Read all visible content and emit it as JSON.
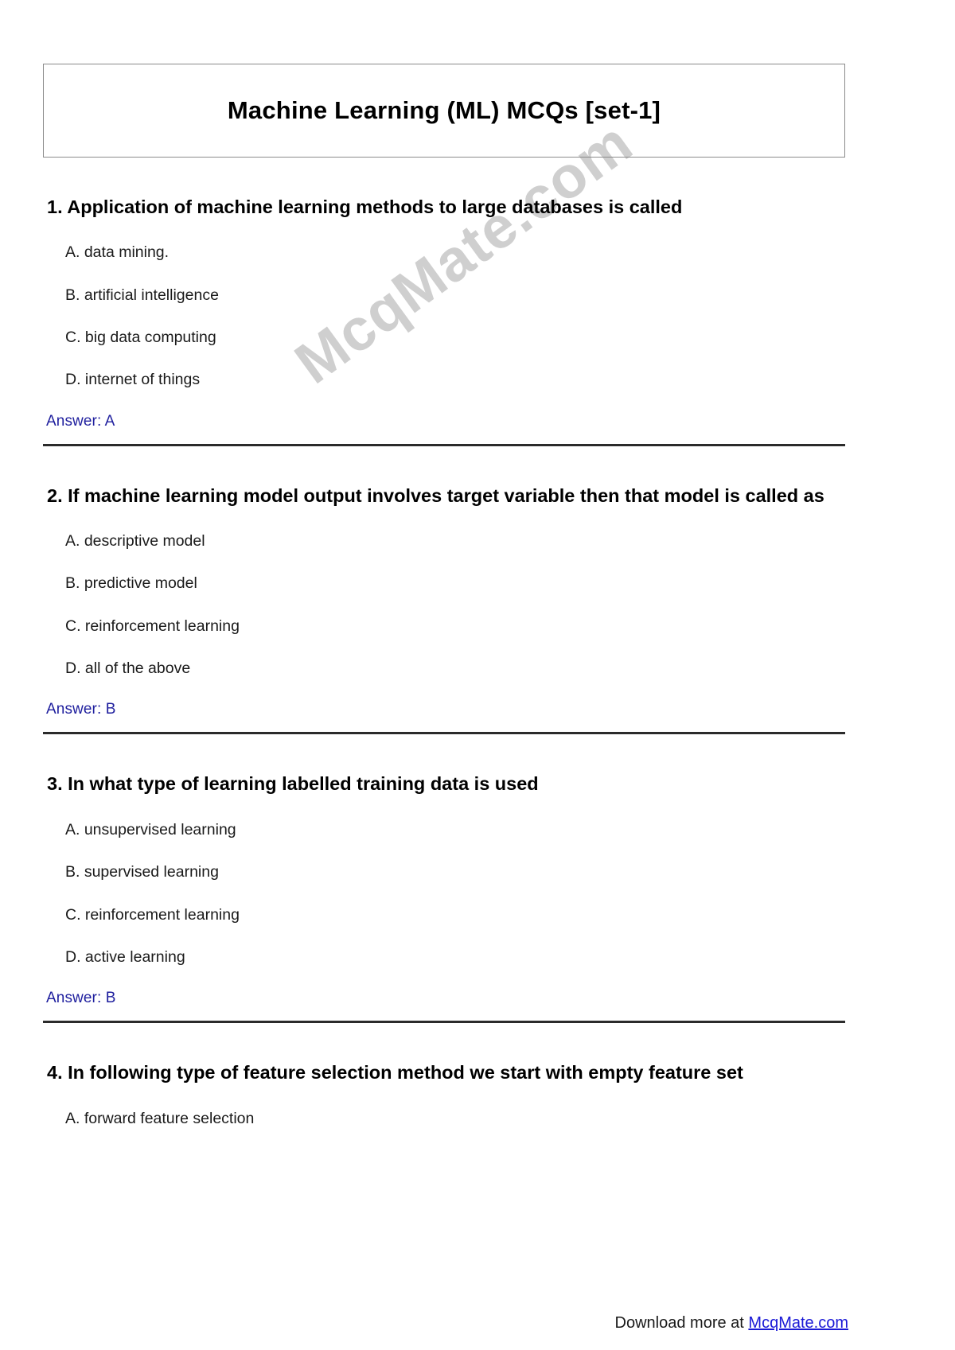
{
  "document": {
    "title": "Machine Learning (ML) MCQs [set-1]",
    "watermark": "McqMate.com",
    "answer_prefix": "Answer: "
  },
  "questions": [
    {
      "number": "1.",
      "text": "1. Application of machine learning methods to large databases is called",
      "options": [
        "A. data mining.",
        "B. artificial intelligence",
        "C. big data computing",
        "D. internet of things"
      ],
      "answer": "Answer: A"
    },
    {
      "number": "2.",
      "text": "2. If machine learning model output involves target variable then that model is called as",
      "options": [
        "A. descriptive model",
        "B. predictive model",
        "C. reinforcement learning",
        "D. all of the above"
      ],
      "answer": "Answer: B"
    },
    {
      "number": "3.",
      "text": "3. In what type of learning labelled training data is used",
      "options": [
        "A. unsupervised learning",
        "B. supervised learning",
        "C. reinforcement learning",
        "D. active learning"
      ],
      "answer": "Answer: B"
    },
    {
      "number": "4.",
      "text": "4. In following type of feature selection method we start with empty feature set",
      "options": [
        "A. forward feature selection"
      ],
      "answer": ""
    }
  ],
  "footer": {
    "prefix": "Download more at ",
    "link_text": "McqMate.com"
  },
  "colors": {
    "answer_blue": "#1f1f9e",
    "link_blue": "#1a19d6",
    "watermark_gray": "#cfcfcf",
    "separator": "#2b2b2b",
    "title_border": "#8a8a8a"
  }
}
